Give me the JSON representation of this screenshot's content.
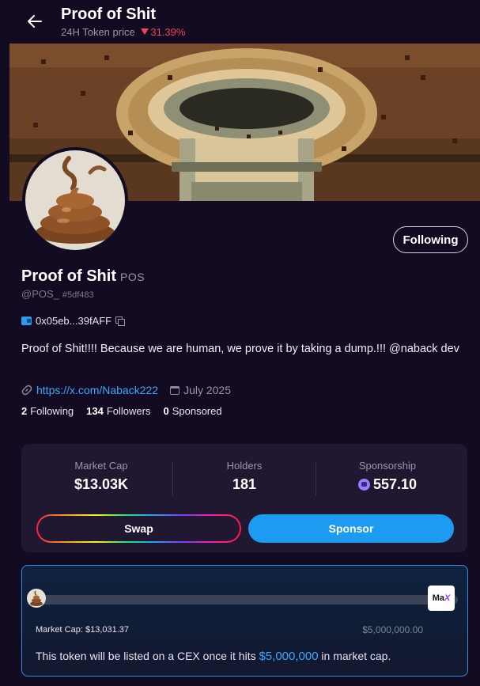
{
  "header": {
    "title": "Proof of Shit",
    "price_label": "24H Token price",
    "price_change": "31.39%",
    "price_direction": "down",
    "change_color": "#f2445a"
  },
  "profile": {
    "name": "Proof of Shit",
    "ticker": "POS",
    "handle": "@POS_",
    "hash": "#5df483",
    "wallet": "0x05eb...39fAFF",
    "bio": "Proof of Shit!!!! Because we are human, we prove it by taking a dump.!!! @naback dev",
    "link": "https://x.com/Naback222",
    "joined": "July 2025",
    "follow_button": "Following"
  },
  "counts": {
    "following_num": "2",
    "following_label": "Following",
    "followers_num": "134",
    "followers_label": "Followers",
    "sponsored_num": "0",
    "sponsored_label": "Sponsored"
  },
  "stats": {
    "market_cap_label": "Market Cap",
    "market_cap_value": "$13.03K",
    "holders_label": "Holders",
    "holders_value": "181",
    "sponsorship_label": "Sponsorship",
    "sponsorship_value": "557.10"
  },
  "actions": {
    "swap_label": "Swap",
    "sponsor_label": "Sponsor"
  },
  "progress": {
    "current_label": "Market Cap: $13,031.37",
    "target_label": "$5,000,000.00",
    "logo_text": "Ma",
    "logo_accent": "X",
    "fraction": 0.0026,
    "note_prefix": "This token will be listed on a CEX once it hits ",
    "note_target": "$5,000,000",
    "note_suffix": " in market cap."
  },
  "colors": {
    "background": "#130b22",
    "accent": "#1d9bf0",
    "link": "#3ea6ff"
  }
}
